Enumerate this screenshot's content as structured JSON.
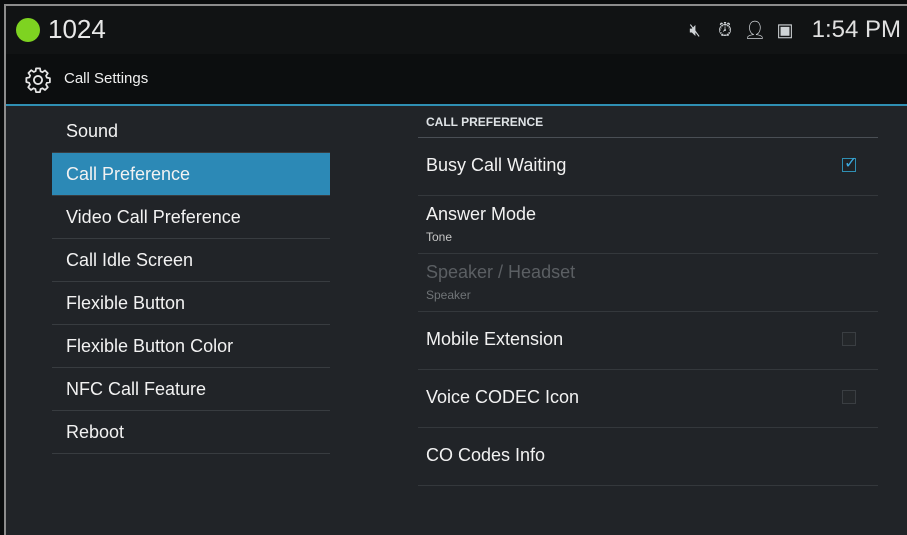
{
  "status": {
    "number": "1024",
    "time": "1:54 PM",
    "icons": [
      "mute-icon",
      "alarm-icon",
      "account-icon",
      "sim-icon"
    ]
  },
  "actionbar": {
    "title": "Call Settings",
    "icon": "gear-icon"
  },
  "menu": {
    "items": [
      {
        "label": "Sound"
      },
      {
        "label": "Call Preference",
        "selected": true
      },
      {
        "label": "Video Call Preference"
      },
      {
        "label": "Call Idle Screen"
      },
      {
        "label": "Flexible Button"
      },
      {
        "label": "Flexible Button Color"
      },
      {
        "label": "NFC Call Feature"
      },
      {
        "label": "Reboot"
      }
    ]
  },
  "panel": {
    "header": "CALL PREFERENCE",
    "rows": [
      {
        "title": "Busy Call Waiting",
        "checked": true
      },
      {
        "title": "Answer Mode",
        "subtitle": "Tone"
      },
      {
        "title": "Speaker / Headset",
        "subtitle": "Speaker",
        "disabled": true
      },
      {
        "title": "Mobile Extension",
        "checked": false
      },
      {
        "title": "Voice CODEC Icon",
        "checked": false
      },
      {
        "title": "CO Codes Info"
      }
    ]
  },
  "colors": {
    "accent": "#2c89b6",
    "status_dot": "#7ed321"
  }
}
